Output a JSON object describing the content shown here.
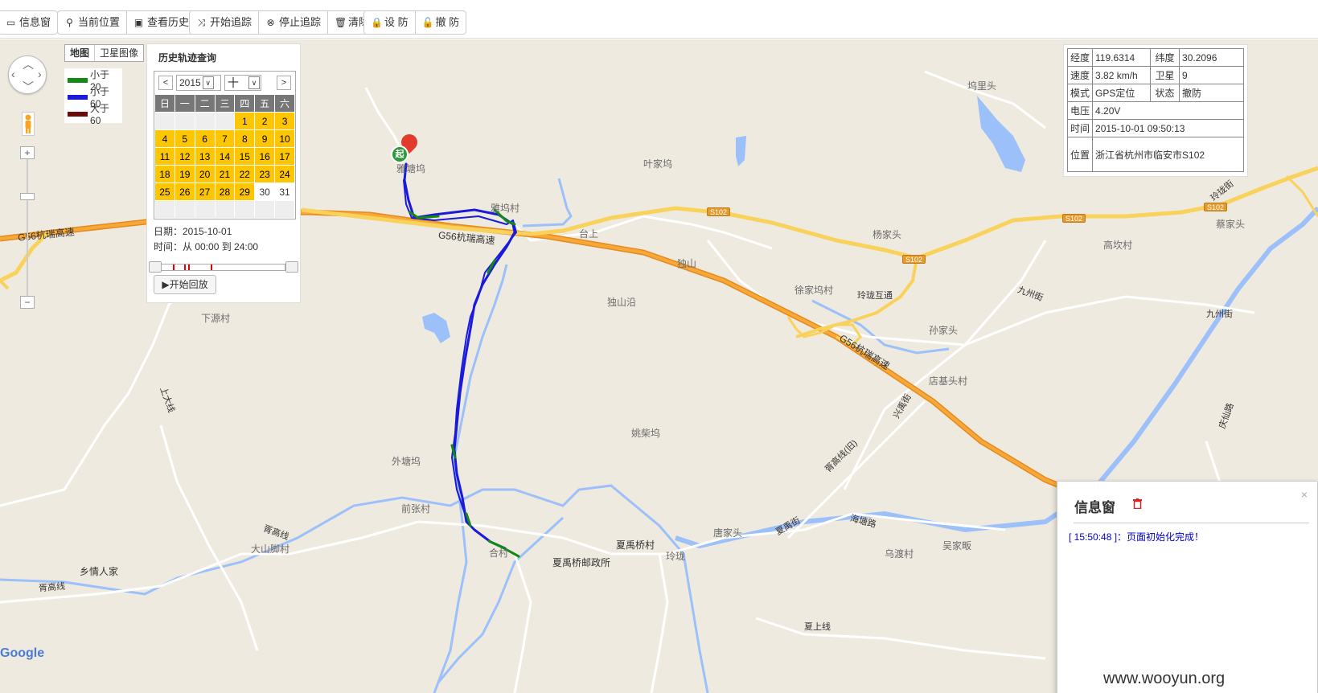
{
  "toolbar": {
    "info_window": "信息窗",
    "current_position": "当前位置",
    "view_history": "查看历史",
    "start_tracking": "开始追踪",
    "stop_tracking": "停止追踪",
    "clear": "清除",
    "arm": "设 防",
    "disarm": "撤 防"
  },
  "map_type": {
    "map": "地图",
    "satellite": "卫星图像"
  },
  "legend": [
    {
      "label": "小于20",
      "color": "#138a13"
    },
    {
      "label": "小于60",
      "color": "#1a1adb"
    },
    {
      "label": "大于60",
      "color": "#6b0a0a"
    }
  ],
  "history": {
    "title": "历史轨迹查询",
    "prev": "<",
    "next": ">",
    "year": "2015",
    "month": "十",
    "weekdays": [
      "日",
      "一",
      "二",
      "三",
      "四",
      "五",
      "六"
    ],
    "date_line": "日期：2015-10-01",
    "time_line": "时间：从 00:00 到 24:00",
    "play_button": "▶开始回放"
  },
  "status": {
    "lng_k": "经度",
    "lng_v": "119.6314",
    "lat_k": "纬度",
    "lat_v": "30.2096",
    "speed_k": "速度",
    "speed_v": "3.82 km/h",
    "sat_k": "卫星",
    "sat_v": "9",
    "mode_k": "模式",
    "mode_v": "GPS定位",
    "state_k": "状态",
    "state_v": "撤防",
    "volt_k": "电压",
    "volt_v": "4.20V",
    "time_k": "时间",
    "time_v": "2015-10-01 09:50:13",
    "loc_k": "位置",
    "loc_v": "浙江省杭州市临安市S102"
  },
  "infowin": {
    "title": "信息窗",
    "close": "×",
    "log": "[ 15:50:48 ]：页面初始化完成！"
  },
  "map_labels": {
    "g56_a": "G56杭瑞高速",
    "g56_b": "G56杭瑞高速",
    "g56_c": "G56杭瑞高速",
    "s102_1": "S102",
    "s102_2": "S102",
    "s102_3": "S102",
    "s102_4": "S102",
    "lane": "玲珑街",
    "jiuzhou1": "九州街",
    "jiuzhou2": "九州街",
    "xingyu": "兴禹街",
    "xugao": "胥高线(旧)",
    "xiayu": "夏禹街",
    "haitang": "海塘路",
    "xugao2": "胥高线",
    "xugao3": "胥高线",
    "shangda": "上大线",
    "xiashang": "夏上线",
    "qingshan": "庆仙路",
    "lingtan": "玲珑互通",
    "village_1": "坞里头",
    "village_2": "叶家坞",
    "village_3": "杨家头",
    "village_4": "高坎村",
    "village_5": "蔡家头",
    "village_6": "台上",
    "village_7": "独山",
    "village_8": "徐家坞村",
    "village_9": "孙家头",
    "village_10": "独山沿",
    "village_11": "店基头村",
    "village_12": "下源村",
    "village_13": "姚柴坞",
    "village_14": "外塘坞",
    "village_15": "前张村",
    "village_16": "大山脚村",
    "village_17": "乡情人家",
    "village_18": "夏禹桥村",
    "village_19": "夏禹桥邮政所",
    "village_20": "唐家头",
    "village_21": "乌渡村",
    "village_22": "吴家畈",
    "village_23": "玲珑",
    "village_24": "雅坞村",
    "village_25": "雅塘坞",
    "village_26": "合村"
  },
  "google": "Google",
  "watermark": "www.wooyun.org",
  "start_marker": "起"
}
